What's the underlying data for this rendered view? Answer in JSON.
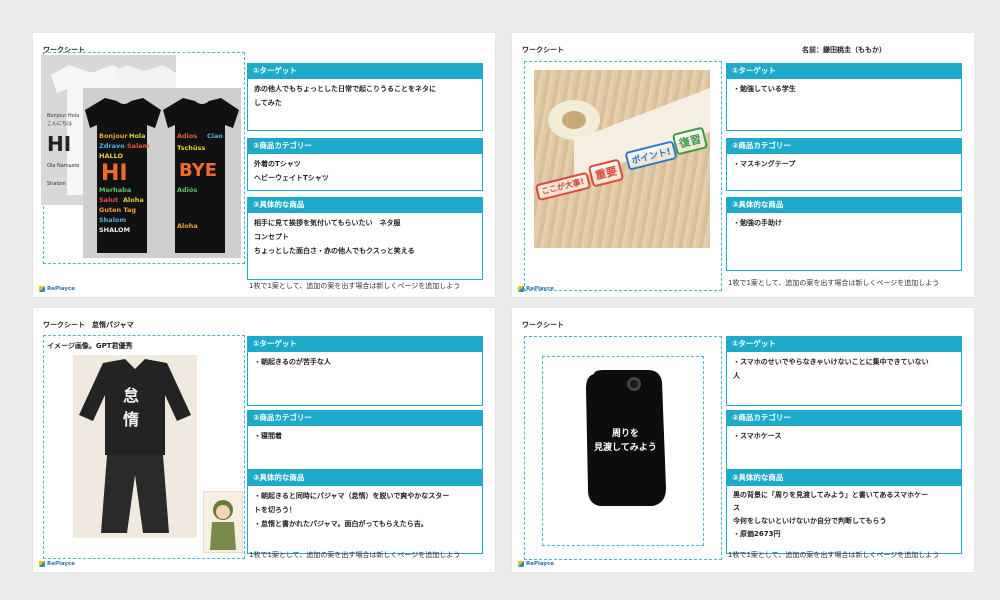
{
  "slides": {
    "s1": {
      "title": "ワークシート",
      "shirt_words": [
        "Bonjour",
        "Hola",
        "Ciao",
        "Zdravo",
        "Salam",
        "HALLO",
        "Hi",
        "Merhaba",
        "Salut",
        "Aloha",
        "Guten Tag",
        "Shalom",
        "SHALOM",
        "Adios",
        "BYE",
        "Ciao",
        "Tschüss",
        "Adiós",
        "Aloha"
      ],
      "shirt_big_front": "HI",
      "shirt_big_back": "BYE",
      "sections": [
        {
          "heading": "①ターゲット",
          "lines": [
            "赤の他人でもちょっとした日常で起こりうることをネタに",
            "してみた"
          ]
        },
        {
          "heading": "②商品カテゴリー",
          "lines": [
            "外着のTシャツ",
            "ヘビーウェイトTシャツ"
          ]
        },
        {
          "heading": "③具体的な商品",
          "lines": [
            "相手に見て挨拶を気付いてもらいたい　ネタ服",
            "コンセプト",
            "ちょっとした面白さ・赤の他人でもクスっと笑える"
          ]
        }
      ],
      "note": "1枚で1案として、追加の案を出す場合は新しくページを追加しよう",
      "logo": "RePlayce"
    },
    "s2": {
      "title": "ワークシート",
      "name_field": "名前：鎌田桃圭（ももか）",
      "tape_stamps": [
        "ここが大事!",
        "重要",
        "ポイント!",
        "復習"
      ],
      "sections": [
        {
          "heading": "①ターゲット",
          "lines": [
            "・勉強している学生"
          ]
        },
        {
          "heading": "②商品カテゴリー",
          "lines": [
            "・マスキングテープ"
          ]
        },
        {
          "heading": "③具体的な商品",
          "lines": [
            "・勉強の手助け"
          ]
        }
      ],
      "note": "1枚で1案として、追加の案を出す場合は新しくページを追加しよう",
      "logo": "RePlayce"
    },
    "s3": {
      "title": "ワークシート　怠惰パジャマ",
      "image_label": "イメージ画像。GPT君優秀",
      "pajama_chars": [
        "怠",
        "惰"
      ],
      "sections": [
        {
          "heading": "①ターゲット",
          "lines": [
            "・朝起きるのが苦手な人"
          ]
        },
        {
          "heading": "②商品カテゴリー",
          "lines": [
            "・寝間着"
          ]
        },
        {
          "heading": "③具体的な商品",
          "lines": [
            "・朝起きると同時にパジャマ（怠惰）を脱いで爽やかなスター",
            "トを切ろう！",
            "・怠惰と書かれたパジャマ。面白がってもらえたら吉。"
          ]
        }
      ],
      "note": "1枚で1案として、追加の案を出す場合は新しくページを追加しよう",
      "logo": "RePlayce"
    },
    "s4": {
      "title": "ワークシート",
      "phone_text": [
        "周りを",
        "見渡してみよう"
      ],
      "sections": [
        {
          "heading": "①ターゲット",
          "lines": [
            "・スマホのせいでやらなきゃいけないことに集中できていない",
            "人"
          ]
        },
        {
          "heading": "②商品カテゴリー",
          "lines": [
            "・スマホケース"
          ]
        },
        {
          "heading": "③具体的な商品",
          "lines": [
            "黒の背景に「周りを見渡してみよう」と書いてあるスマホケー",
            "ス",
            "今何をしないといけないか自分で判断してもらう",
            "・原価2673円"
          ]
        }
      ],
      "note": "1枚で1案として、追加の案を出す場合は新しくページを追加しよう",
      "logo": "RePlayce"
    }
  },
  "colors": {
    "accent": "#1eaacb",
    "frame": "#4db6d6"
  }
}
